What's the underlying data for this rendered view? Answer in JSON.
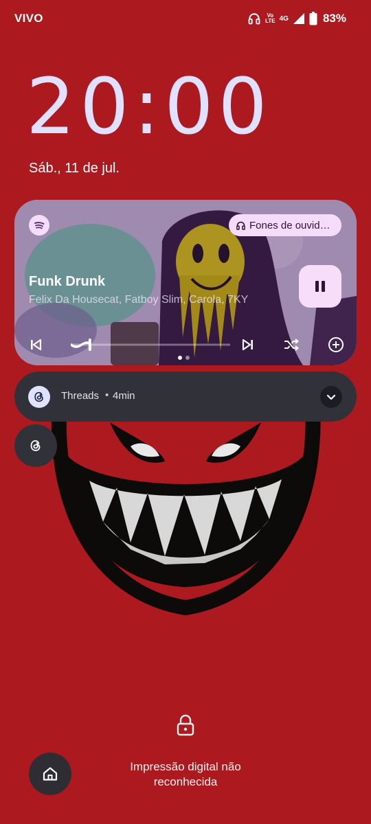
{
  "status_bar": {
    "carrier": "VIVO",
    "volte_top": "Vo",
    "volte_bottom": "LTE",
    "network": "4G",
    "battery": "83%",
    "icons": [
      "headphones-icon",
      "volte-icon",
      "signal-icon",
      "battery-icon"
    ]
  },
  "lockscreen": {
    "time": "20:00",
    "date": "Sáb., 11 de jul."
  },
  "media": {
    "app": "spotify",
    "output_label": "Fones de ouvid…",
    "title": "Funk Drunk",
    "artist": "Felix Da Housecat, Fatboy Slim, Carola, 7KY",
    "state": "playing",
    "progress_fraction": 0.12,
    "page_indicator": {
      "count": 2,
      "active": 0
    }
  },
  "notification": {
    "app": "Threads",
    "separator": "•",
    "time": "4min"
  },
  "bottom": {
    "fingerprint_message": "Impressão digital não reconhecida"
  },
  "colors": {
    "wallpaper": "#ac1a20",
    "clock": "#dfe1ff",
    "notification_bg": "#313239",
    "media_accent": "#f8ddf9"
  }
}
